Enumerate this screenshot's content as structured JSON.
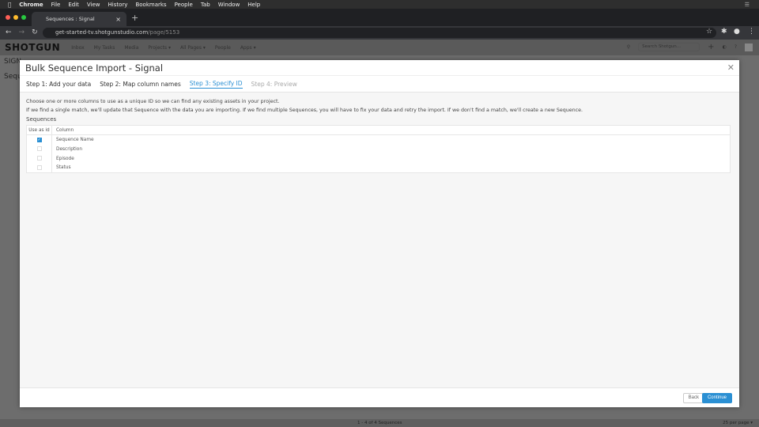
{
  "menubar": {
    "apple": "",
    "items": [
      "Chrome",
      "File",
      "Edit",
      "View",
      "History",
      "Bookmarks",
      "People",
      "Tab",
      "Window",
      "Help"
    ]
  },
  "browser": {
    "tab_title": "Sequences : Signal",
    "url_host": "get-started-tv.shotgunstudio.com",
    "url_path": "/page/5153"
  },
  "app_nav": {
    "logo": "SHOTGUN",
    "items": [
      "Inbox",
      "My Tasks",
      "Media",
      "Projects ▾",
      "All Pages ▾",
      "People",
      "Apps ▾"
    ],
    "search_placeholder": "Search Shotgun..."
  },
  "background": {
    "project": "SIGN",
    "page": "Sequ",
    "footer_count": "1 - 4 of 4 Sequences",
    "per_page": "25 per page ▾"
  },
  "modal": {
    "title": "Bulk Sequence Import - Signal",
    "steps": [
      "Step 1: Add your data",
      "Step 2: Map column names",
      "Step 3: Specify ID",
      "Step 4: Preview"
    ],
    "instructions": [
      "Choose one or more columns to use as a unique ID so we can find any existing assets in your project.",
      "If we find a single match, we'll update that Sequence with the data you are importing. If we find multiple Sequences, you will have to fix your data and retry the import. If we don't find a match, we'll create a new Sequence."
    ],
    "section": "Sequences",
    "headers": [
      "Use as id",
      "Column"
    ],
    "rows": [
      {
        "checked": true,
        "column": "Sequence Name"
      },
      {
        "checked": false,
        "column": "Description"
      },
      {
        "checked": false,
        "column": "Episode"
      },
      {
        "checked": false,
        "column": "Status"
      }
    ],
    "back": "Back",
    "continue": "Continue"
  },
  "colors": {
    "accent": "#2a8fd3"
  }
}
